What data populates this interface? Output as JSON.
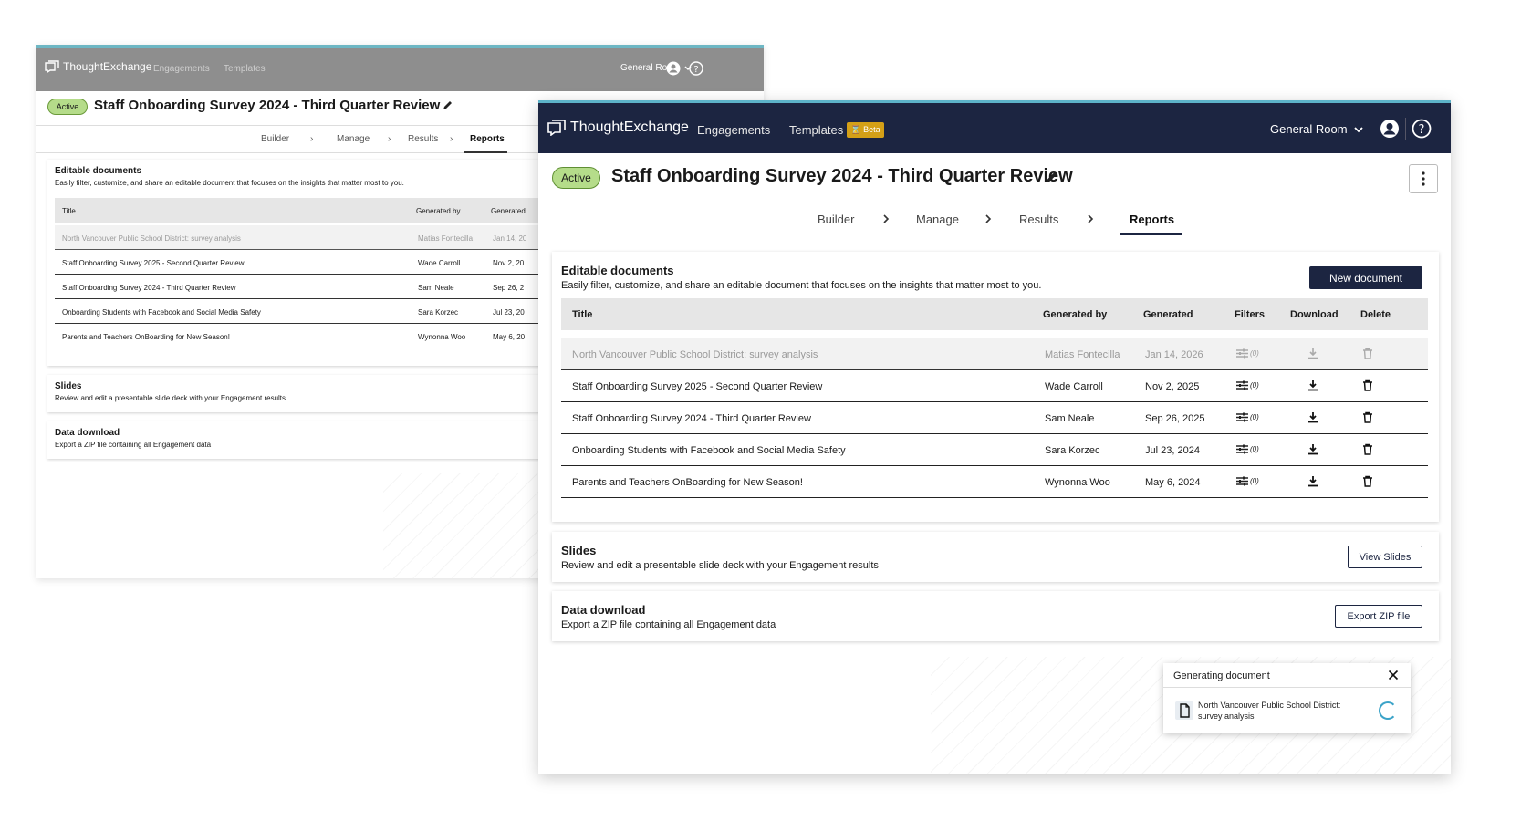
{
  "app": {
    "logo": "ThoughtExchange",
    "nav": [
      "Engagements",
      "Templates"
    ],
    "beta_label": "Beta",
    "room": "General Room"
  },
  "engagement": {
    "status": "Active",
    "title": "Staff Onboarding Survey 2024 - Third Quarter Review"
  },
  "tabs": [
    "Builder",
    "Manage",
    "Results",
    "Reports"
  ],
  "editable": {
    "title": "Editable documents",
    "desc": "Easily filter, customize, and share an editable document that focuses on the insights that matter most to you.",
    "new_btn": "New document",
    "columns": [
      "Title",
      "Generated by",
      "Generated",
      "Filters",
      "Download",
      "Delete"
    ],
    "back_columns": [
      "Title",
      "Generated by",
      "Generated"
    ],
    "rows": [
      {
        "title": "North Vancouver Public School District: survey analysis",
        "by": "Matias Fontecilla",
        "date": "Jan 14, 2026",
        "date_short": "Jan 14, 20",
        "filters": "(0)"
      },
      {
        "title": "Staff Onboarding Survey 2025 - Second Quarter Review",
        "by": "Wade Carroll",
        "date": "Nov 2, 2025",
        "date_short": "Nov 2, 20",
        "filters": "(0)"
      },
      {
        "title": "Staff Onboarding Survey 2024 - Third Quarter Review",
        "by": "Sam Neale",
        "date": "Sep 26, 2025",
        "date_short": "Sep 26, 2",
        "filters": "(0)"
      },
      {
        "title": "Onboarding Students with Facebook and Social Media Safety",
        "by": "Sara Korzec",
        "date": "Jul 23, 2024",
        "date_short": "Jul 23, 20",
        "filters": "(0)"
      },
      {
        "title": "Parents and Teachers OnBoarding for New Season!",
        "by": "Wynonna Woo",
        "date": "May 6, 2024",
        "date_short": "May 6, 20",
        "filters": "(0)"
      }
    ]
  },
  "slides": {
    "title": "Slides",
    "desc": "Review and edit a presentable slide deck with your Engagement results",
    "btn": "View Slides"
  },
  "data_download": {
    "title": "Data download",
    "desc": "Export a ZIP file containing all Engagement data",
    "btn": "Export ZIP file"
  },
  "toast": {
    "title": "Generating document",
    "message": "North Vancouver Public School District: survey analysis"
  },
  "colors": {
    "navy": "#1c2541",
    "accent": "#5db3c9",
    "active_green": "#b5dc8a",
    "beta": "#d4a017"
  }
}
